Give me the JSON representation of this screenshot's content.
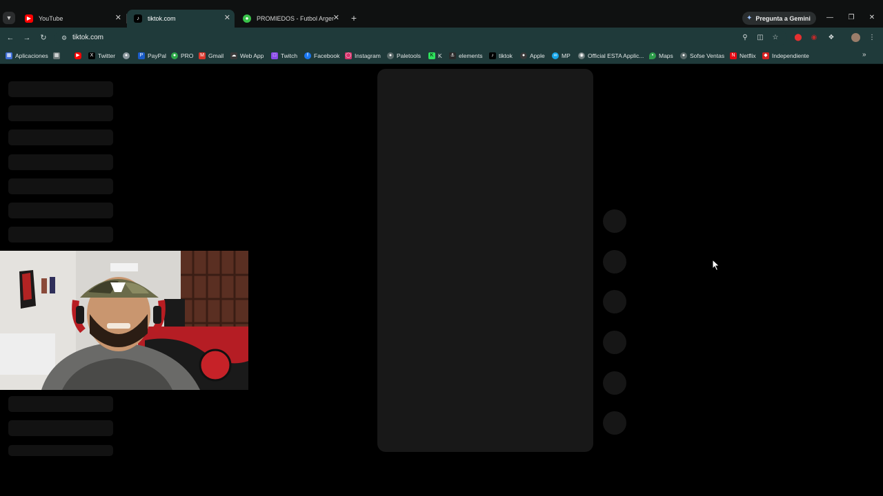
{
  "tabs": [
    {
      "title": "YouTube",
      "icon": "youtube-icon",
      "color": "#ff0000"
    },
    {
      "title": "tiktok.com",
      "icon": "tiktok-icon",
      "color": "#ffffff",
      "active": true
    },
    {
      "title": "PROMIEDOS - Futbol Argentino",
      "icon": "promiedos-icon",
      "color": "#39c24a"
    }
  ],
  "gemini_label": "Pregunta a Gemini",
  "address": {
    "url": "tiktok.com"
  },
  "bookmarks": [
    {
      "label": "Aplicaciones",
      "icon": "apps-grid-icon",
      "color": "#3f6fd8"
    },
    {
      "label": "",
      "icon": "grid-icon",
      "color": "#6e7a7a"
    },
    {
      "label": "",
      "icon": "youtube-icon",
      "color": "#ff0000"
    },
    {
      "label": "Twitter",
      "icon": "x-icon",
      "color": "#000000"
    },
    {
      "label": "",
      "icon": "extension-icon",
      "color": "#8d9aa0"
    },
    {
      "label": "PayPal",
      "icon": "paypal-icon",
      "color": "#1a5cc8"
    },
    {
      "label": "PRO",
      "icon": "pro-icon",
      "color": "#2ea84a"
    },
    {
      "label": "Gmail",
      "icon": "gmail-icon",
      "color": "#d9362b"
    },
    {
      "label": "Web App",
      "icon": "webapp-icon",
      "color": "#3a3a3a"
    },
    {
      "label": "Twitch",
      "icon": "twitch-icon",
      "color": "#8a4be8"
    },
    {
      "label": "Facebook",
      "icon": "facebook-icon",
      "color": "#1877f2"
    },
    {
      "label": "Instagram",
      "icon": "instagram-icon",
      "color": "#d6336c"
    },
    {
      "label": "Paletools",
      "icon": "paletools-icon",
      "color": "#5b6b6b"
    },
    {
      "label": "K",
      "icon": "kick-icon",
      "color": "#2ee05c"
    },
    {
      "label": "elements",
      "icon": "anchor-icon",
      "color": "#2a2a2a"
    },
    {
      "label": "tiktok",
      "icon": "tiktok-icon",
      "color": "#000000"
    },
    {
      "label": "Apple",
      "icon": "apple-icon",
      "color": "#3a3a3a"
    },
    {
      "label": "MP",
      "icon": "mercadopago-icon",
      "color": "#16a5e8"
    },
    {
      "label": "Official ESTA Applic...",
      "icon": "esta-icon",
      "color": "#6b7a7a"
    },
    {
      "label": "Maps",
      "icon": "maps-pin-icon",
      "color": "#2f9d4c"
    },
    {
      "label": "Sofse Ventas",
      "icon": "sofse-icon",
      "color": "#5b6b6b"
    },
    {
      "label": "Netflix",
      "icon": "netflix-icon",
      "color": "#e50914"
    },
    {
      "label": "Independiente",
      "icon": "independiente-icon",
      "color": "#d42020"
    }
  ],
  "theme": {
    "accent": "#1f3a3a",
    "background": "#000000"
  }
}
